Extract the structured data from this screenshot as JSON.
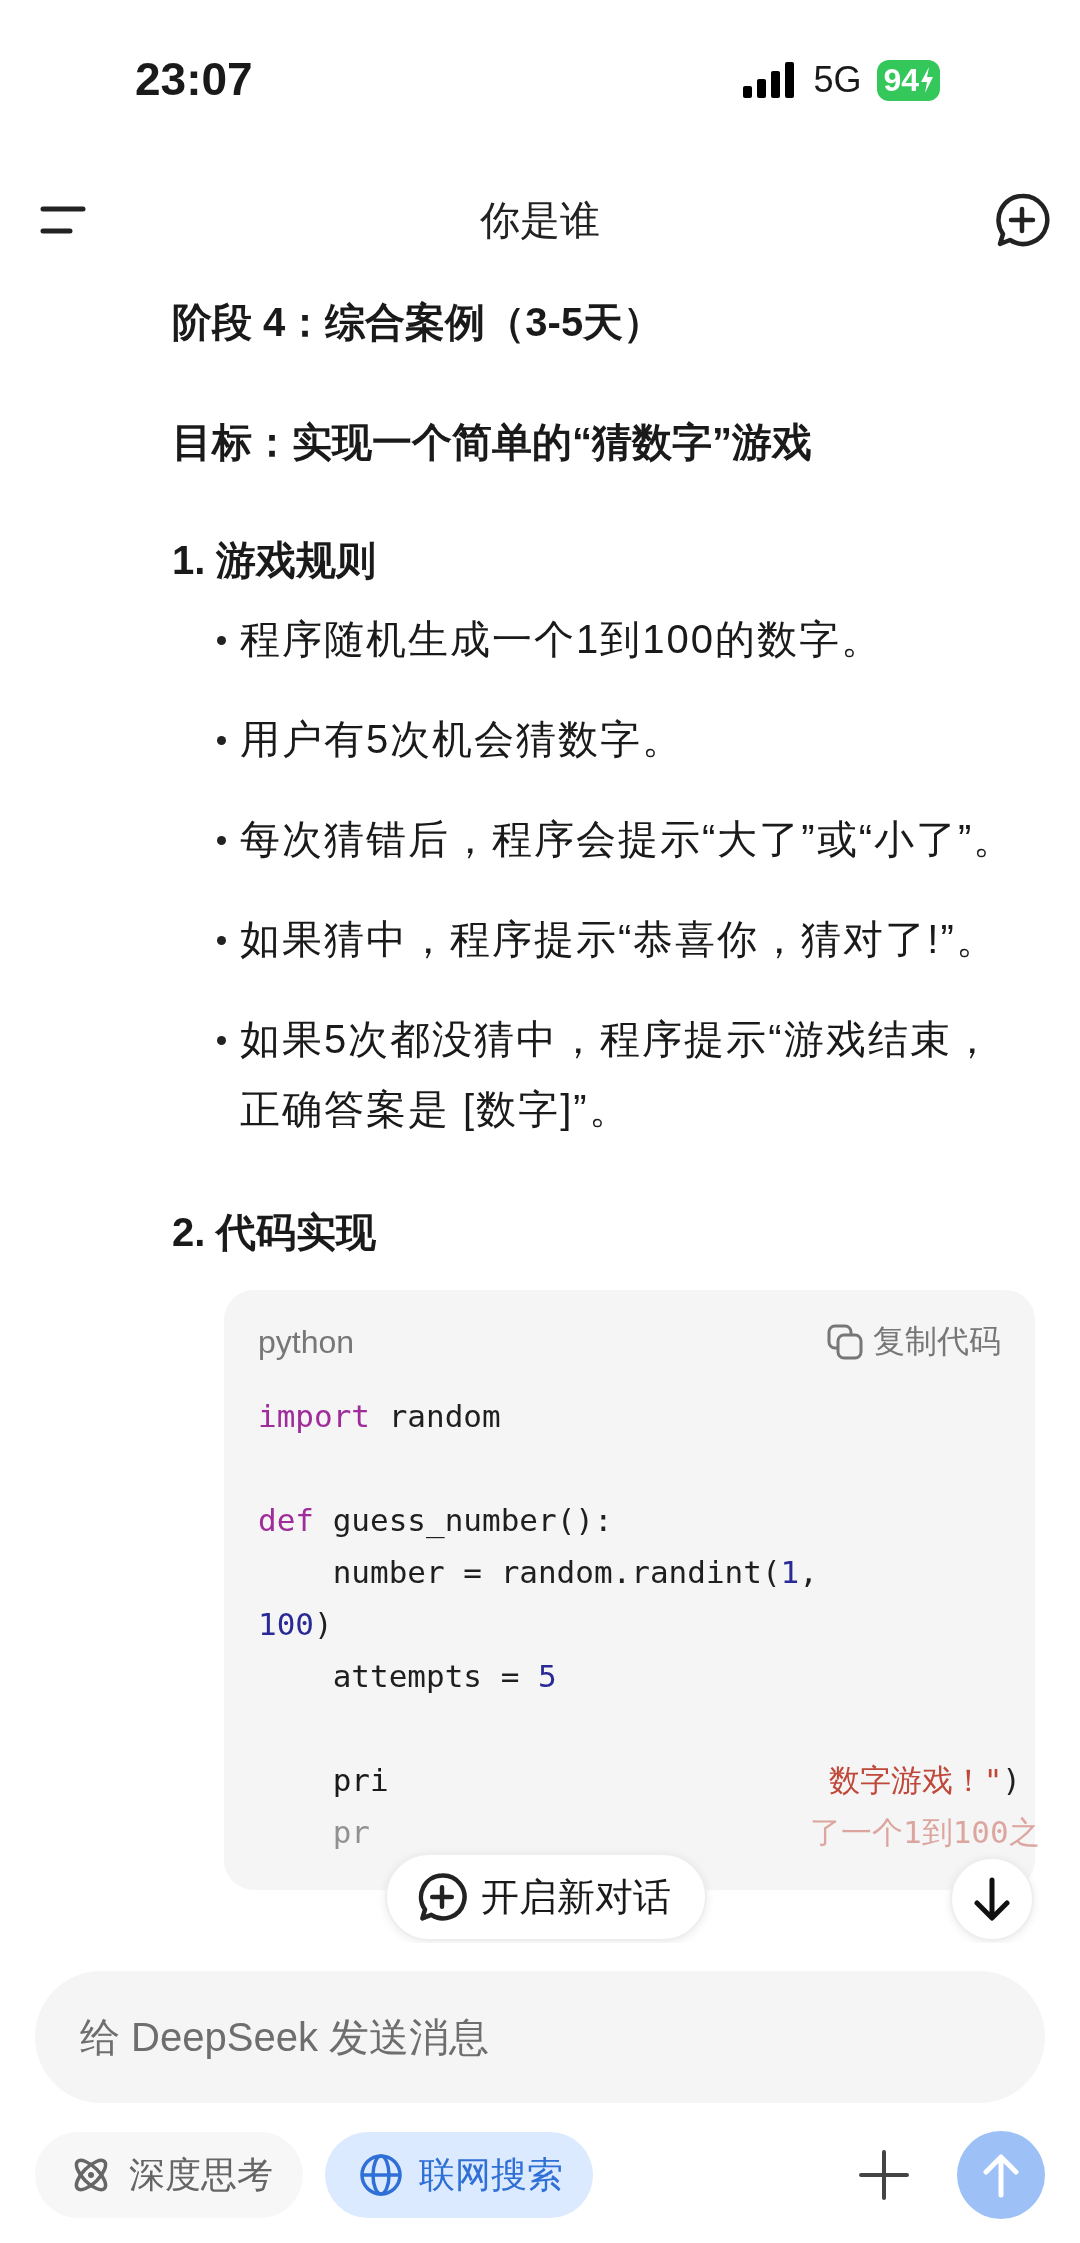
{
  "status_bar": {
    "time": "23:07",
    "network": "5G",
    "battery": "94"
  },
  "header": {
    "title": "你是谁"
  },
  "message": {
    "heading": "阶段 4：综合案例（3-5天）",
    "goal": "目标：实现一个简单的“猜数字”游戏",
    "sections": [
      {
        "title": "1. 游戏规则",
        "bullets": [
          "程序随机生成一个1到100的数字。",
          "用户有5次机会猜数字。",
          "每次猜错后，程序会提示“大了”或“小了”。",
          "如果猜中，程序提示“恭喜你，猜对了!”。",
          "如果5次都没猜中，程序提示“游戏结束，正确答案是 [数字]”。"
        ]
      },
      {
        "title": "2. 代码实现"
      }
    ]
  },
  "code_block": {
    "language": "python",
    "copy_label": "复制代码",
    "lines": [
      {
        "kind": "code",
        "tokens": [
          {
            "t": "import",
            "kind": "keyword"
          },
          {
            "t": " random",
            "kind": "plain"
          }
        ]
      },
      {
        "kind": "blank"
      },
      {
        "kind": "code",
        "tokens": [
          {
            "t": "def",
            "kind": "keyword"
          },
          {
            "t": " guess_number():",
            "kind": "plain"
          }
        ]
      },
      {
        "kind": "code",
        "tokens": [
          {
            "t": "    number = random.randint(",
            "kind": "plain"
          },
          {
            "t": "1",
            "kind": "number"
          },
          {
            "t": ",",
            "kind": "plain"
          }
        ]
      },
      {
        "kind": "code",
        "tokens": [
          {
            "t": "100",
            "kind": "number"
          },
          {
            "t": ")",
            "kind": "plain"
          }
        ]
      },
      {
        "kind": "code",
        "tokens": [
          {
            "t": "    attempts = ",
            "kind": "plain"
          },
          {
            "t": "5",
            "kind": "number"
          }
        ]
      },
      {
        "kind": "blank"
      },
      {
        "kind": "covered",
        "left": "    pri",
        "right": [
          {
            "t": "数字游戏！\"",
            "kind": "string"
          },
          {
            "t": ")",
            "kind": "plain"
          }
        ]
      },
      {
        "kind": "covered",
        "left": "    pr",
        "right": [
          {
            "t": "了一个1到100之",
            "kind": "string"
          }
        ]
      }
    ]
  },
  "new_chat_button": {
    "label": "开启新对话"
  },
  "composer": {
    "placeholder": "给 DeepSeek 发送消息",
    "toggles": [
      {
        "label": "深度思考",
        "selected": false,
        "kind": "think"
      },
      {
        "label": "联网搜索",
        "selected": true,
        "kind": "search"
      }
    ]
  }
}
